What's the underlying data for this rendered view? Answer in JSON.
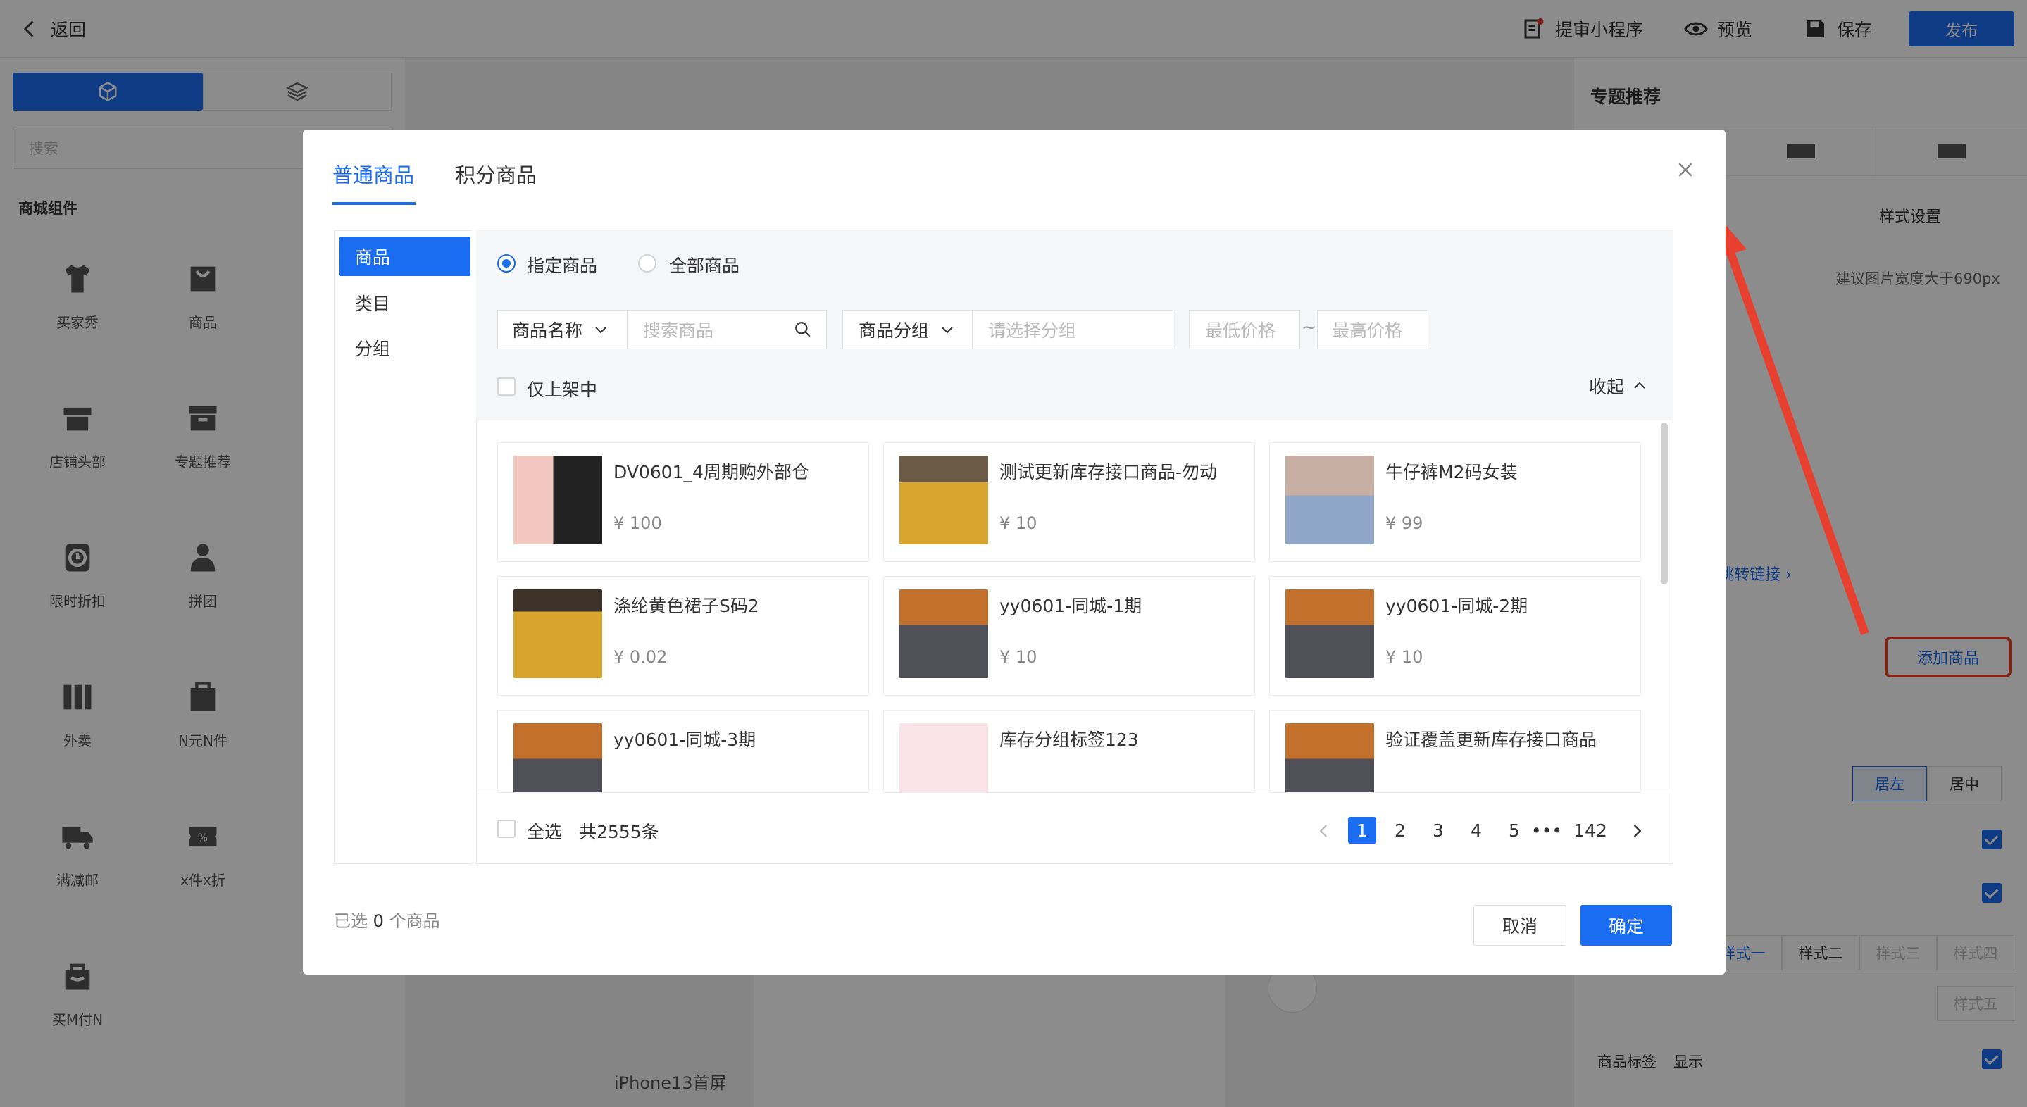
{
  "topbar": {
    "back_label": "返回",
    "review_label": "提审小程序",
    "preview_label": "预览",
    "save_label": "保存",
    "publish_label": "发布"
  },
  "left_panel": {
    "search_placeholder": "搜索",
    "section_title": "商城组件",
    "components": [
      {
        "label": "买家秀",
        "icon": "tshirt-icon"
      },
      {
        "label": "商品",
        "icon": "shopping-bag-icon"
      },
      {
        "label": "店铺头部",
        "icon": "store-icon"
      },
      {
        "label": "专题推荐",
        "icon": "box-icon"
      },
      {
        "label": "限时折扣",
        "icon": "clock-icon"
      },
      {
        "label": "拼团",
        "icon": "group-icon"
      },
      {
        "label": "外卖",
        "icon": "columns-icon"
      },
      {
        "label": "N元N件",
        "icon": "price-bag-icon"
      },
      {
        "label": "满减邮",
        "icon": "truck-icon"
      },
      {
        "label": "x件x折",
        "icon": "discount-ticket-icon"
      },
      {
        "label": "买M付N",
        "icon": "gift-bag-icon"
      }
    ]
  },
  "canvas": {
    "page_label": "iPhone13首屏"
  },
  "right_panel": {
    "title": "专题推荐",
    "style_settings": "样式设置",
    "image_hint": "建议图片宽度大于690px",
    "jump_link": "跳转链接",
    "add_product": "添加商品",
    "align_left": "居左",
    "align_center": "居中",
    "style_options": [
      "样式一",
      "样式二",
      "样式三",
      "样式四",
      "样式五"
    ],
    "product_tag_label": "商品标签",
    "product_tag_value": "显示"
  },
  "modal": {
    "tabs": [
      "普通商品",
      "积分商品"
    ],
    "side_nav": [
      "商品",
      "类目",
      "分组"
    ],
    "radio_specific": "指定商品",
    "radio_all": "全部商品",
    "name_select": "商品名称",
    "search_placeholder": "搜索商品",
    "group_select": "商品分组",
    "group_placeholder": "请选择分组",
    "min_price_placeholder": "最低价格",
    "max_price_placeholder": "最高价格",
    "range_sep": "~",
    "only_on_shelf": "仅上架中",
    "collapse": "收起",
    "products": [
      {
        "name": "DV0601_4周期购外部仓",
        "price": "¥ 100"
      },
      {
        "name": "测试更新库存接口商品-勿动",
        "price": "¥ 10"
      },
      {
        "name": "牛仔裤M2码女装",
        "price": "¥ 99"
      },
      {
        "name": "涤纶黄色裙子S码2",
        "price": "¥ 0.02"
      },
      {
        "name": "yy0601-同城-1期",
        "price": "¥ 10"
      },
      {
        "name": "yy0601-同城-2期",
        "price": "¥ 10"
      },
      {
        "name": "yy0601-同城-3期",
        "price": ""
      },
      {
        "name": "库存分组标签123",
        "price": ""
      },
      {
        "name": "验证覆盖更新库存接口商品",
        "price": ""
      }
    ],
    "select_all": "全选",
    "total": "共2555条",
    "pages": [
      "1",
      "2",
      "3",
      "4",
      "5",
      "•••",
      "142"
    ],
    "current_page": "1",
    "selected_prefix": "已选",
    "selected_count": "0",
    "selected_suffix": "个商品",
    "cancel": "取消",
    "confirm": "确定"
  },
  "colors": {
    "accent": "#1a6cf0",
    "annotation": "#e8402e"
  }
}
